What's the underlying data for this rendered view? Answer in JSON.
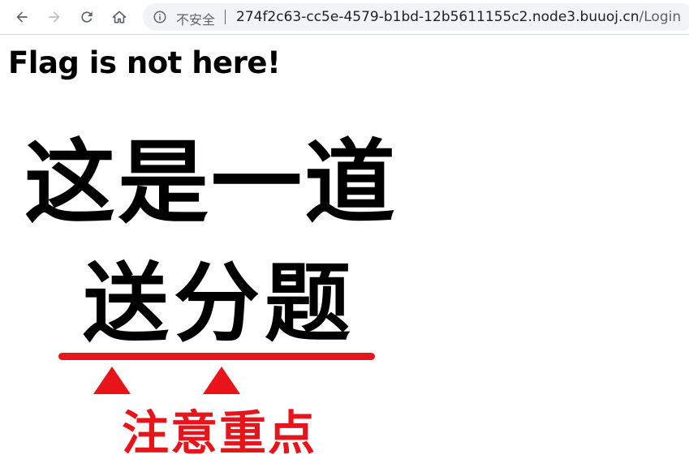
{
  "browser": {
    "security_label": "不安全",
    "url_host": "274f2c63-cc5e-4579-b1bd-12b5611155c2.node3.buuoj.cn",
    "url_path": "/Login",
    "icons": [
      "back-arrow-icon",
      "forward-arrow-icon",
      "reload-icon",
      "home-icon",
      "info-icon"
    ]
  },
  "page": {
    "heading": "Flag is not here!",
    "meme": {
      "line1": "这是一道",
      "line2": "送分题",
      "note": "注意重点",
      "accent_color": "#e8141b"
    }
  }
}
